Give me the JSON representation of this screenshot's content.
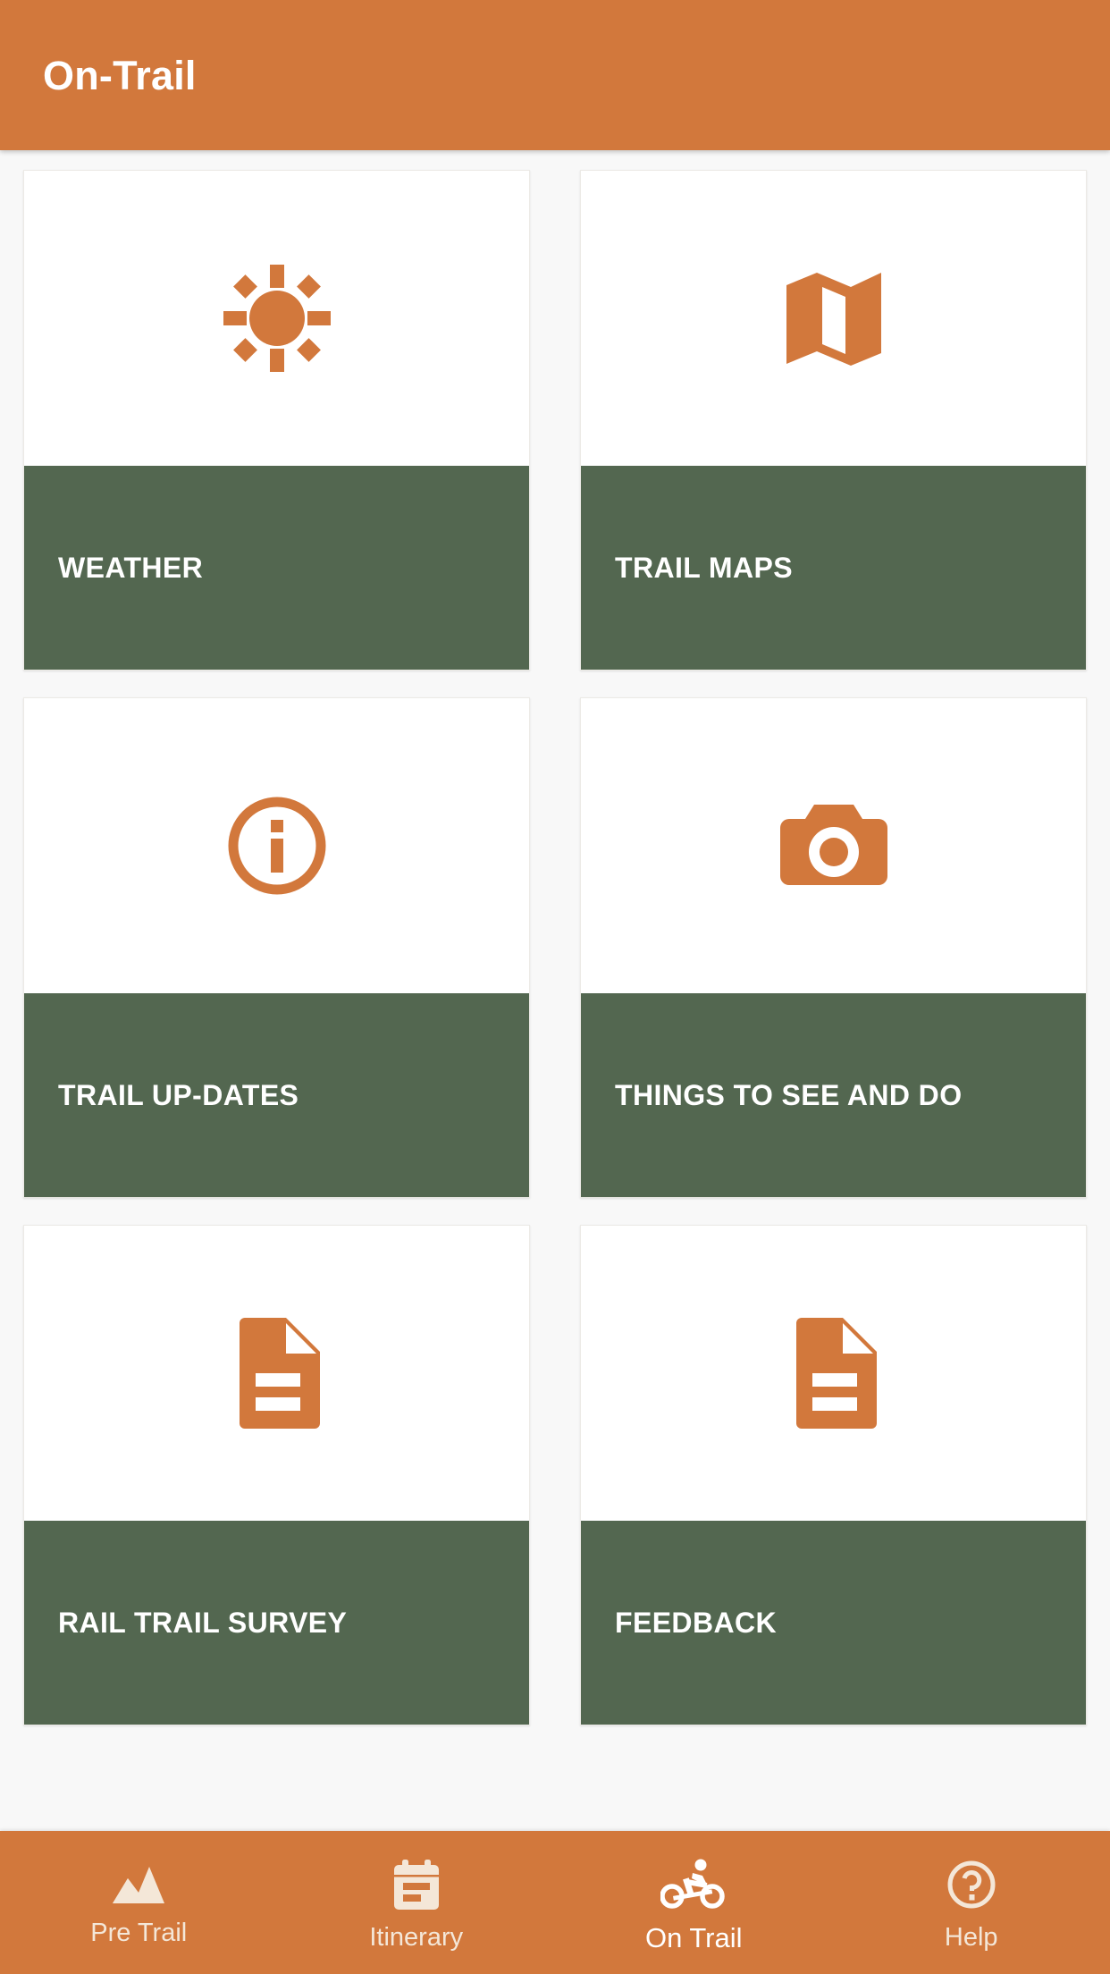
{
  "header": {
    "title": "On-Trail"
  },
  "colors": {
    "accent_orange": "#D2783C",
    "tile_green": "#536750",
    "page_background": "#F8F8F8",
    "tile_white": "#FFFFFF",
    "label_text": "#FFFFFF",
    "nav_inactive_text": "#F4E7D8",
    "nav_active_text": "#FFFFFF"
  },
  "grid": {
    "tiles": [
      {
        "label": "WEATHER",
        "icon": "sun-icon"
      },
      {
        "label": "TRAIL MAPS",
        "icon": "map-icon"
      },
      {
        "label": "TRAIL UP-DATES",
        "icon": "info-circle-icon"
      },
      {
        "label": "THINGS TO SEE AND DO",
        "icon": "camera-icon"
      },
      {
        "label": "RAIL TRAIL SURVEY",
        "icon": "document-icon"
      },
      {
        "label": "FEEDBACK",
        "icon": "document-icon"
      }
    ]
  },
  "bottom_nav": {
    "items": [
      {
        "label": "Pre Trail",
        "icon": "mountains-icon",
        "active": false
      },
      {
        "label": "Itinerary",
        "icon": "calendar-icon",
        "active": false
      },
      {
        "label": "On Trail",
        "icon": "cyclist-icon",
        "active": true
      },
      {
        "label": "Help",
        "icon": "question-circle-icon",
        "active": false
      }
    ]
  }
}
